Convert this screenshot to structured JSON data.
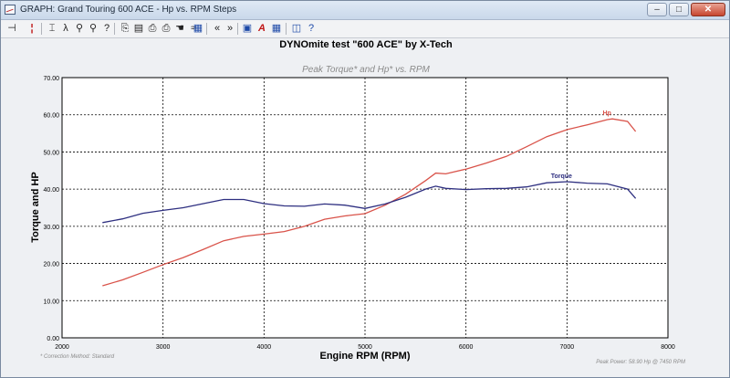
{
  "window": {
    "title": "GRAPH: Grand Touring 600 ACE - Hp vs. RPM Steps"
  },
  "window_buttons": {
    "minimize": "–",
    "maximize": "□",
    "close": "✕"
  },
  "toolbar_icons": [
    "pin-icon",
    "marker-icon",
    "cursor-icon",
    "lambda-icon",
    "zoom-icon",
    "zoom-out-icon",
    "copy-icon",
    "paste-icon",
    "print-icon",
    "print-preview-icon",
    "hand-icon",
    "wave-icon",
    "table-icon",
    "back-icon",
    "forward-icon",
    "chart-icon",
    "text-icon",
    "notebook-icon",
    "help-icon"
  ],
  "header": {
    "title": "DYNOmite test \"600 ACE\" by X-Tech"
  },
  "chart_data": {
    "type": "line",
    "subtitle": "Peak Torque* and Hp* vs. RPM",
    "xlabel": "Engine RPM (RPM)",
    "ylabel": "Torque and HP",
    "xlim": [
      2000,
      8000
    ],
    "ylim": [
      0,
      70
    ],
    "x_ticks": [
      "2000",
      "3000",
      "4000",
      "5000",
      "6000",
      "7000",
      "8000"
    ],
    "y_ticks": [
      "0.00",
      "10.00",
      "20.00",
      "30.00",
      "40.00",
      "50.00",
      "60.00",
      "70.00"
    ],
    "grid": true,
    "series": [
      {
        "name": "Hp",
        "color": "#d9534a",
        "points": [
          [
            2400,
            14.0
          ],
          [
            2600,
            15.6
          ],
          [
            2800,
            17.6
          ],
          [
            3000,
            19.7
          ],
          [
            3200,
            21.6
          ],
          [
            3400,
            23.8
          ],
          [
            3600,
            26.1
          ],
          [
            3800,
            27.3
          ],
          [
            4000,
            27.9
          ],
          [
            4200,
            28.6
          ],
          [
            4400,
            30.0
          ],
          [
            4600,
            31.9
          ],
          [
            4800,
            32.8
          ],
          [
            5000,
            33.4
          ],
          [
            5200,
            35.7
          ],
          [
            5400,
            38.6
          ],
          [
            5600,
            42.3
          ],
          [
            5700,
            44.3
          ],
          [
            5800,
            44.1
          ],
          [
            6000,
            45.4
          ],
          [
            6200,
            47.0
          ],
          [
            6400,
            48.8
          ],
          [
            6600,
            51.4
          ],
          [
            6800,
            54.1
          ],
          [
            7000,
            56.0
          ],
          [
            7200,
            57.3
          ],
          [
            7400,
            58.7
          ],
          [
            7450,
            58.9
          ],
          [
            7600,
            58.2
          ],
          [
            7680,
            55.5
          ]
        ]
      },
      {
        "name": "Torque",
        "color": "#2e2f80",
        "points": [
          [
            2400,
            31.0
          ],
          [
            2600,
            32.0
          ],
          [
            2800,
            33.5
          ],
          [
            3000,
            34.3
          ],
          [
            3200,
            35.0
          ],
          [
            3400,
            36.1
          ],
          [
            3600,
            37.2
          ],
          [
            3800,
            37.2
          ],
          [
            4000,
            36.1
          ],
          [
            4200,
            35.5
          ],
          [
            4400,
            35.4
          ],
          [
            4600,
            36.0
          ],
          [
            4800,
            35.7
          ],
          [
            5000,
            34.8
          ],
          [
            5200,
            36.0
          ],
          [
            5400,
            37.8
          ],
          [
            5600,
            40.0
          ],
          [
            5700,
            40.8
          ],
          [
            5800,
            40.2
          ],
          [
            6000,
            39.9
          ],
          [
            6200,
            40.1
          ],
          [
            6400,
            40.2
          ],
          [
            6600,
            40.6
          ],
          [
            6800,
            41.7
          ],
          [
            7000,
            42.0
          ],
          [
            7200,
            41.6
          ],
          [
            7400,
            41.4
          ],
          [
            7600,
            40.0
          ],
          [
            7680,
            37.5
          ]
        ]
      }
    ]
  },
  "footer": {
    "correction": "* Correction Method: Standard",
    "peak_power": "Peak Power: 58.90 Hp @ 7450 RPM"
  }
}
